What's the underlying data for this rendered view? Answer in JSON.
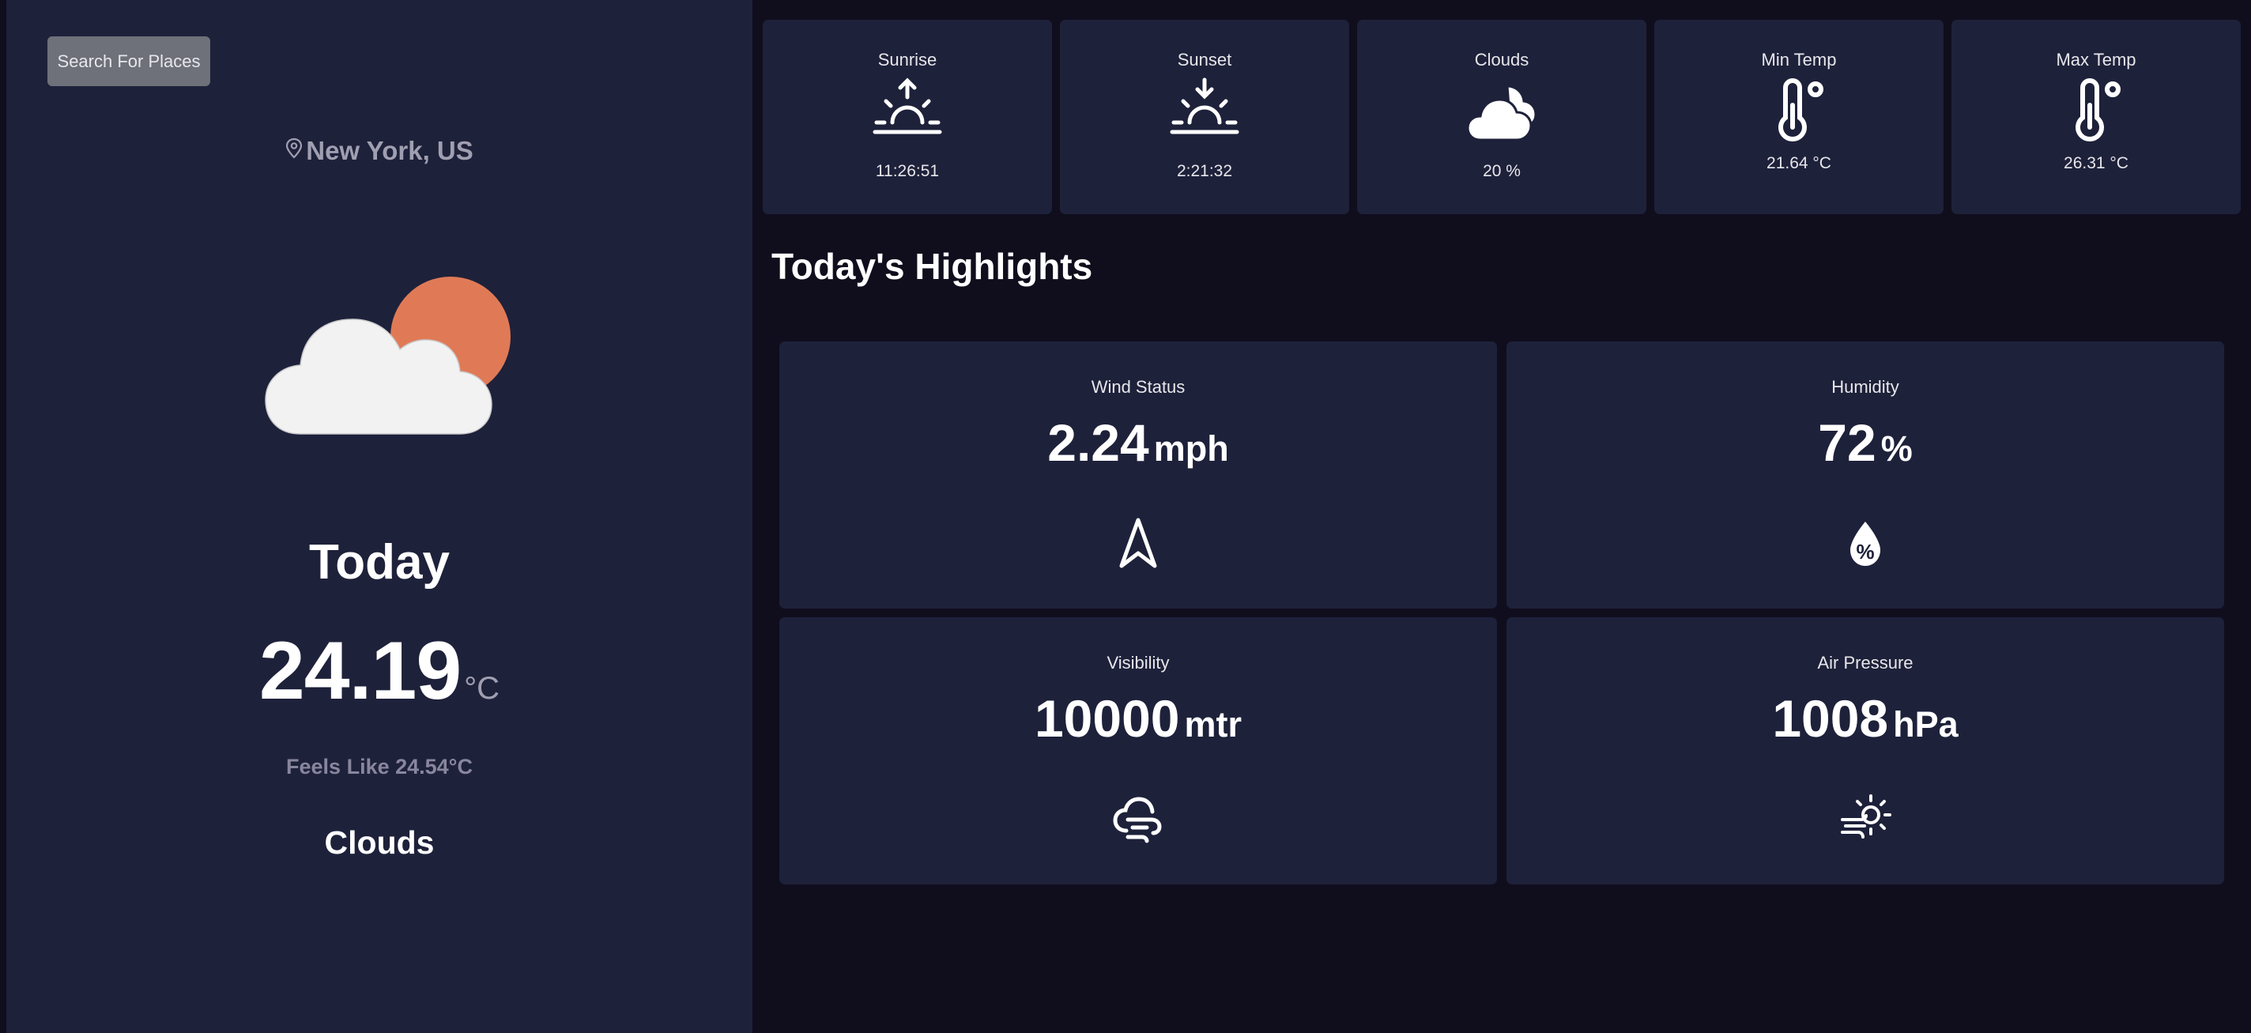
{
  "sidebar": {
    "search_label": "Search For Places",
    "location": "New York, US",
    "weather_icon": "cloud-sun-icon",
    "day_label": "Today",
    "temperature": "24.19",
    "temperature_unit": "°C",
    "feels_like": "Feels Like 24.54°C",
    "condition": "Clouds"
  },
  "summary_cards": [
    {
      "label": "Sunrise",
      "value": "11:26:51",
      "icon": "sunrise-icon"
    },
    {
      "label": "Sunset",
      "value": "2:21:32",
      "icon": "sunset-icon"
    },
    {
      "label": "Clouds",
      "value": "20 %",
      "icon": "clouds-icon"
    },
    {
      "label": "Min Temp",
      "value": "21.64 °C",
      "icon": "thermometer-icon"
    },
    {
      "label": "Max Temp",
      "value": "26.31 °C",
      "icon": "thermometer-icon"
    }
  ],
  "highlights": {
    "title": "Today's Highlights",
    "wind": {
      "label": "Wind Status",
      "value": "2.24",
      "unit": "mph",
      "icon": "navigation-arrow-icon"
    },
    "humidity": {
      "label": "Humidity",
      "value": "72",
      "unit": "%",
      "icon": "humidity-drop-icon"
    },
    "visibility": {
      "label": "Visibility",
      "value": "10000",
      "unit": "mtr",
      "icon": "windy-cloud-icon"
    },
    "pressure": {
      "label": "Air Pressure",
      "value": "1008",
      "unit": "hPa",
      "icon": "sun-wind-icon"
    }
  },
  "colors": {
    "page_background": "#100e1d",
    "panel_background": "#1e213a",
    "button_background": "#6e707a",
    "sun": "#e07a56",
    "cloud": "#f2f2f2",
    "muted_text": "#a09fb1"
  }
}
